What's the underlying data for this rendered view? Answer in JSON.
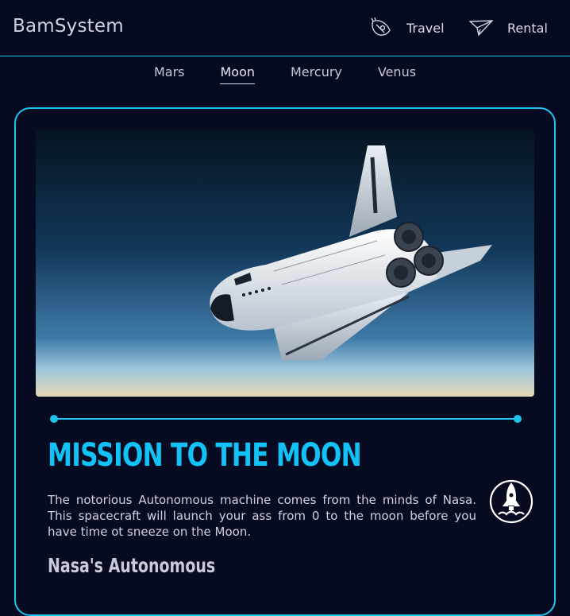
{
  "header": {
    "brand": "BamSystem",
    "nav": [
      {
        "label": "Travel",
        "icon": "rocket-icon"
      },
      {
        "label": "Rental",
        "icon": "paper-plane-icon"
      }
    ]
  },
  "tabs": [
    {
      "label": "Mars",
      "active": false
    },
    {
      "label": "Moon",
      "active": true
    },
    {
      "label": "Mercury",
      "active": false
    },
    {
      "label": "Venus",
      "active": false
    }
  ],
  "card": {
    "image_alt": "space-shuttle",
    "title": "MISSION TO THE MOON",
    "description": "The notorious Autonomous machine comes from the minds of Nasa. This spacecraft will launch your ass from 0 to the moon before you have time ot sneeze on the Moon.",
    "subtitle": "Nasa's Autonomous",
    "badge_icon": "rocket-launch-icon"
  },
  "colors": {
    "background": "#060a20",
    "accent": "#20c3f0",
    "text": "#d9dbe6"
  }
}
